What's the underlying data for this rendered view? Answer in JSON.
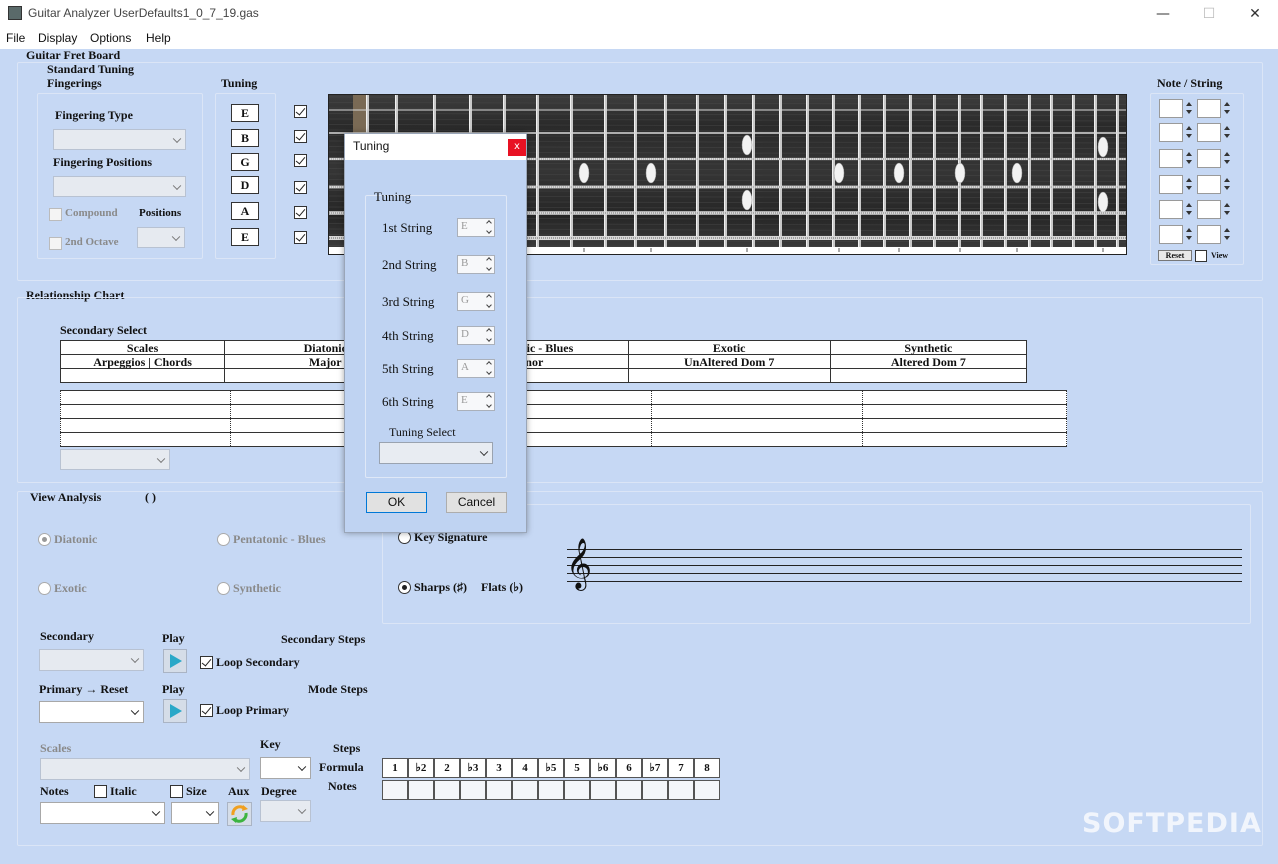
{
  "window": {
    "title": "Guitar Analyzer  UserDefaults1_0_7_19.gas",
    "minimize": "—",
    "maximize": "☐",
    "close": "✕"
  },
  "menu": [
    "File",
    "Display",
    "Options",
    "Help"
  ],
  "fretboard_panel": {
    "heading": "Guitar Fret Board",
    "tuning_name": "Standard Tuning",
    "fingerings": "Fingerings",
    "fingering_type": "Fingering Type",
    "fingering_positions": "Fingering Positions",
    "compound": "Compound",
    "positions": "Positions",
    "second_octave": "2nd Octave",
    "tuning_label": "Tuning",
    "strings": [
      "E",
      "B",
      "G",
      "D",
      "A",
      "E"
    ]
  },
  "note_string": {
    "heading": "Note / String",
    "reset": "Reset",
    "view": "View"
  },
  "relationship": {
    "heading": "Relationship Chart",
    "secondary_select": "Secondary Select",
    "header_row": [
      "Scales",
      "Diatonic",
      "Pentatonic - Blues",
      "Exotic",
      "Synthetic"
    ],
    "sub_row": [
      "Arpeggios  |  Chords",
      "Major",
      "Minor",
      "UnAltered Dom 7",
      "Altered Dom 7"
    ]
  },
  "view_analysis": {
    "heading": "View Analysis",
    "parens": "(  )",
    "diatonic": "Diatonic",
    "pentatonic": "Pentatonic - Blues",
    "exotic": "Exotic",
    "synthetic": "Synthetic",
    "key_signature": "Key Signature",
    "sharps": "Sharps (♯)",
    "flats": "Flats (♭)"
  },
  "controls": {
    "secondary": "Secondary",
    "play": "Play",
    "secondary_steps": "Secondary Steps",
    "loop_secondary": "Loop Secondary",
    "primary_reset": "Primary → Reset",
    "mode_steps": "Mode Steps",
    "loop_primary": "Loop Primary",
    "scales": "Scales",
    "key": "Key",
    "steps": "Steps",
    "formula": "Formula",
    "notes_label": "Notes",
    "notes": "Notes",
    "italic": "Italic",
    "size": "Size",
    "aux": "Aux",
    "degree": "Degree",
    "formula_steps": [
      "1",
      "♭2",
      "2",
      "♭3",
      "3",
      "4",
      "♭5",
      "5",
      "♭6",
      "6",
      "♭7",
      "7",
      "8"
    ]
  },
  "dialog": {
    "title": "Tuning",
    "close": "x",
    "group": "Tuning",
    "strings": [
      {
        "label": "1st String",
        "value": "E"
      },
      {
        "label": "2nd String",
        "value": "B"
      },
      {
        "label": "3rd String",
        "value": "G"
      },
      {
        "label": "4th String",
        "value": "D"
      },
      {
        "label": "5th String",
        "value": "A"
      },
      {
        "label": "6th String",
        "value": "E"
      }
    ],
    "tuning_select": "Tuning Select",
    "ok": "OK",
    "cancel": "Cancel"
  },
  "clef": "𝄞",
  "watermark": "SOFTPEDIA"
}
